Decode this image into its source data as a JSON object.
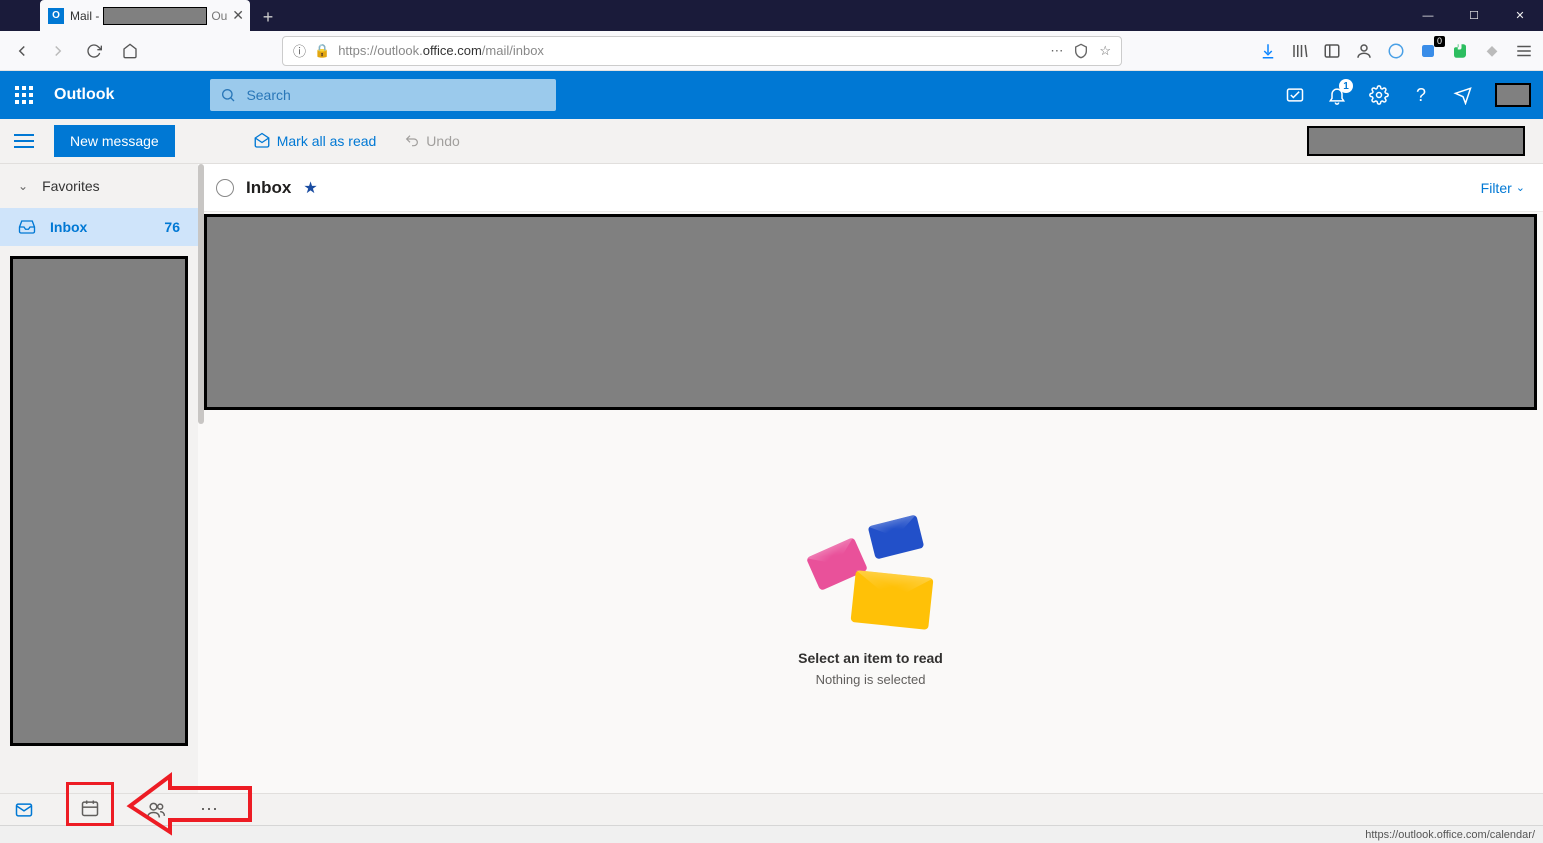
{
  "browser": {
    "tab_prefix": "Mail -",
    "tab_suffix": "Ou",
    "url_proto": "https://",
    "url_pre": "outlook.",
    "url_host": "office.com",
    "url_path": "/mail/inbox"
  },
  "owa": {
    "app_name": "Outlook",
    "search_placeholder": "Search",
    "notification_count": "1"
  },
  "cmdbar": {
    "new_message": "New message",
    "mark_all_read": "Mark all as read",
    "undo": "Undo"
  },
  "sidebar": {
    "favorites": "Favorites",
    "inbox_label": "Inbox",
    "inbox_count": "76"
  },
  "inbox": {
    "title": "Inbox",
    "filter": "Filter",
    "empty_title": "Select an item to read",
    "empty_sub": "Nothing is selected"
  },
  "status": {
    "hover_url": "https://outlook.office.com/calendar/"
  }
}
